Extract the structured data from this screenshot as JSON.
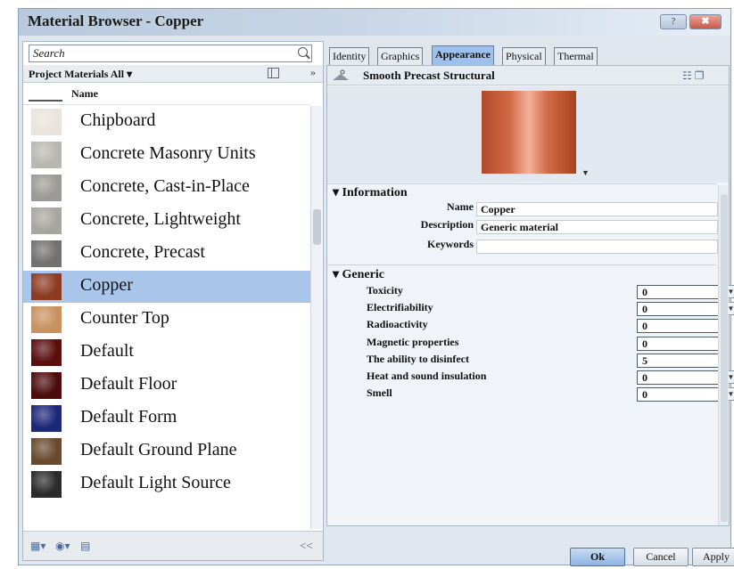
{
  "window": {
    "title": "Material Browser - Copper",
    "help_label": "?",
    "close_label": "✖"
  },
  "left": {
    "search_placeholder": "Search",
    "project_label": "Project Materials All",
    "column_header": "Name",
    "expand_glyph": "»",
    "collapse_glyph": "<<",
    "materials": [
      {
        "label": "Chipboard",
        "thumb": "#e8e4dc"
      },
      {
        "label": "Concrete Masonry Units",
        "thumb": "#b9b7b2"
      },
      {
        "label": "Concrete, Cast-in-Place",
        "thumb": "#9c9a96"
      },
      {
        "label": "Concrete, Lightweight",
        "thumb": "#a7a5a0"
      },
      {
        "label": "Concrete, Precast",
        "thumb": "#737170"
      },
      {
        "label": "Copper",
        "thumb": "#8c3b24",
        "selected": true
      },
      {
        "label": "Counter Top",
        "thumb": "#c8915f"
      },
      {
        "label": "Default",
        "thumb": "#5a0f0f"
      },
      {
        "label": "Default Floor",
        "thumb": "#4d0c0c"
      },
      {
        "label": "Default Form",
        "thumb": "#1e2878"
      },
      {
        "label": "Default Ground Plane",
        "thumb": "#6a4a2f"
      },
      {
        "label": "Default Light Source",
        "thumb": "#2b2b2b"
      }
    ]
  },
  "tabs": [
    {
      "label": "Identity"
    },
    {
      "label": "Graphics"
    },
    {
      "label": "Appearance",
      "active": true
    },
    {
      "label": "Physical"
    },
    {
      "label": "Thermal"
    }
  ],
  "asset": {
    "name": "Smooth Precast Structural",
    "tools_glyph": "☷ ❐"
  },
  "information": {
    "heading": "▾ Information",
    "name_label": "Name",
    "name_value": "Copper",
    "description_label": "Description",
    "description_value": "Generic material",
    "keywords_label": "Keywords",
    "keywords_value": ""
  },
  "generic": {
    "heading": "▾ Generic",
    "fields": [
      {
        "label": "Toxicity",
        "value": "0"
      },
      {
        "label": "Electrifiability",
        "value": "0"
      },
      {
        "label": "Radioactivity",
        "value": "0"
      },
      {
        "label": "Magnetic properties",
        "value": "0"
      },
      {
        "label": "The ability to disinfect",
        "value": "5"
      },
      {
        "label": "Heat and sound insulation",
        "value": "0"
      },
      {
        "label": "Smell",
        "value": "0"
      }
    ]
  },
  "buttons": {
    "ok": "Ok",
    "cancel": "Cancel",
    "apply": "Apply"
  }
}
